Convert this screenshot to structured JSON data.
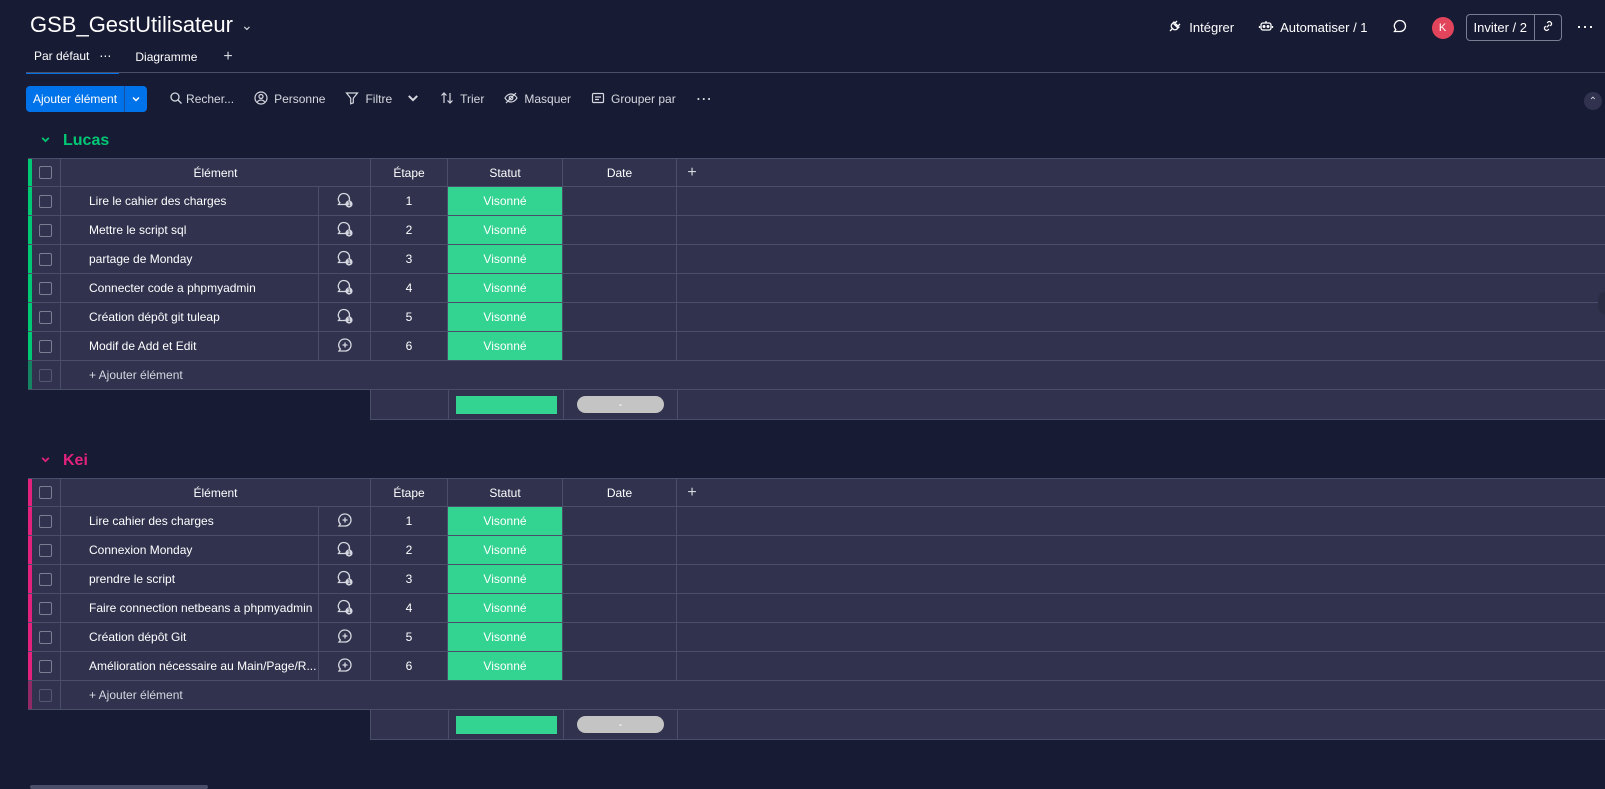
{
  "header": {
    "board_title": "GSB_GestUtilisateur",
    "integrate": "Intégrer",
    "automate": "Automatiser / 1",
    "avatar_initial": "K",
    "invite": "Inviter / 2"
  },
  "tabs": {
    "default": "Par défaut",
    "diagram": "Diagramme",
    "add": "+"
  },
  "toolbar": {
    "add_item": "Ajouter élément",
    "search": "Recher...",
    "person": "Personne",
    "filter": "Filtre",
    "sort": "Trier",
    "hide": "Masquer",
    "group_by": "Grouper par"
  },
  "columns": {
    "element": "Élément",
    "step": "Étape",
    "status": "Statut",
    "date": "Date"
  },
  "colors": {
    "accent": "#0073ea",
    "done": "#33d391",
    "lucas": "#00c875",
    "kei": "#e2227c"
  },
  "groups": [
    {
      "name": "Lucas",
      "add_item_label": "+ Ajouter élément",
      "summary_date": "-",
      "items": [
        {
          "name": "Lire le cahier des charges",
          "step": "1",
          "status": "Visonné",
          "has_updates": true
        },
        {
          "name": "Mettre le script sql",
          "step": "2",
          "status": "Visonné",
          "has_updates": true
        },
        {
          "name": "partage de Monday",
          "step": "3",
          "status": "Visonné",
          "has_updates": true
        },
        {
          "name": "Connecter code a phpmyadmin",
          "step": "4",
          "status": "Visonné",
          "has_updates": true
        },
        {
          "name": "Création dépôt git tuleap",
          "step": "5",
          "status": "Visonné",
          "has_updates": true
        },
        {
          "name": "Modif de Add et Edit",
          "step": "6",
          "status": "Visonné",
          "has_updates": false
        }
      ]
    },
    {
      "name": "Kei",
      "add_item_label": "+ Ajouter élément",
      "summary_date": "-",
      "items": [
        {
          "name": "Lire cahier des charges",
          "step": "1",
          "status": "Visonné",
          "has_updates": false
        },
        {
          "name": "Connexion Monday",
          "step": "2",
          "status": "Visonné",
          "has_updates": true
        },
        {
          "name": "prendre le script",
          "step": "3",
          "status": "Visonné",
          "has_updates": true
        },
        {
          "name": "Faire connection netbeans a phpmyadmin",
          "step": "4",
          "status": "Visonné",
          "has_updates": true
        },
        {
          "name": "Création dépôt Git",
          "step": "5",
          "status": "Visonné",
          "has_updates": false
        },
        {
          "name": "Amélioration nécessaire au Main/Page/R...",
          "step": "6",
          "status": "Visonné",
          "has_updates": false
        }
      ]
    }
  ]
}
